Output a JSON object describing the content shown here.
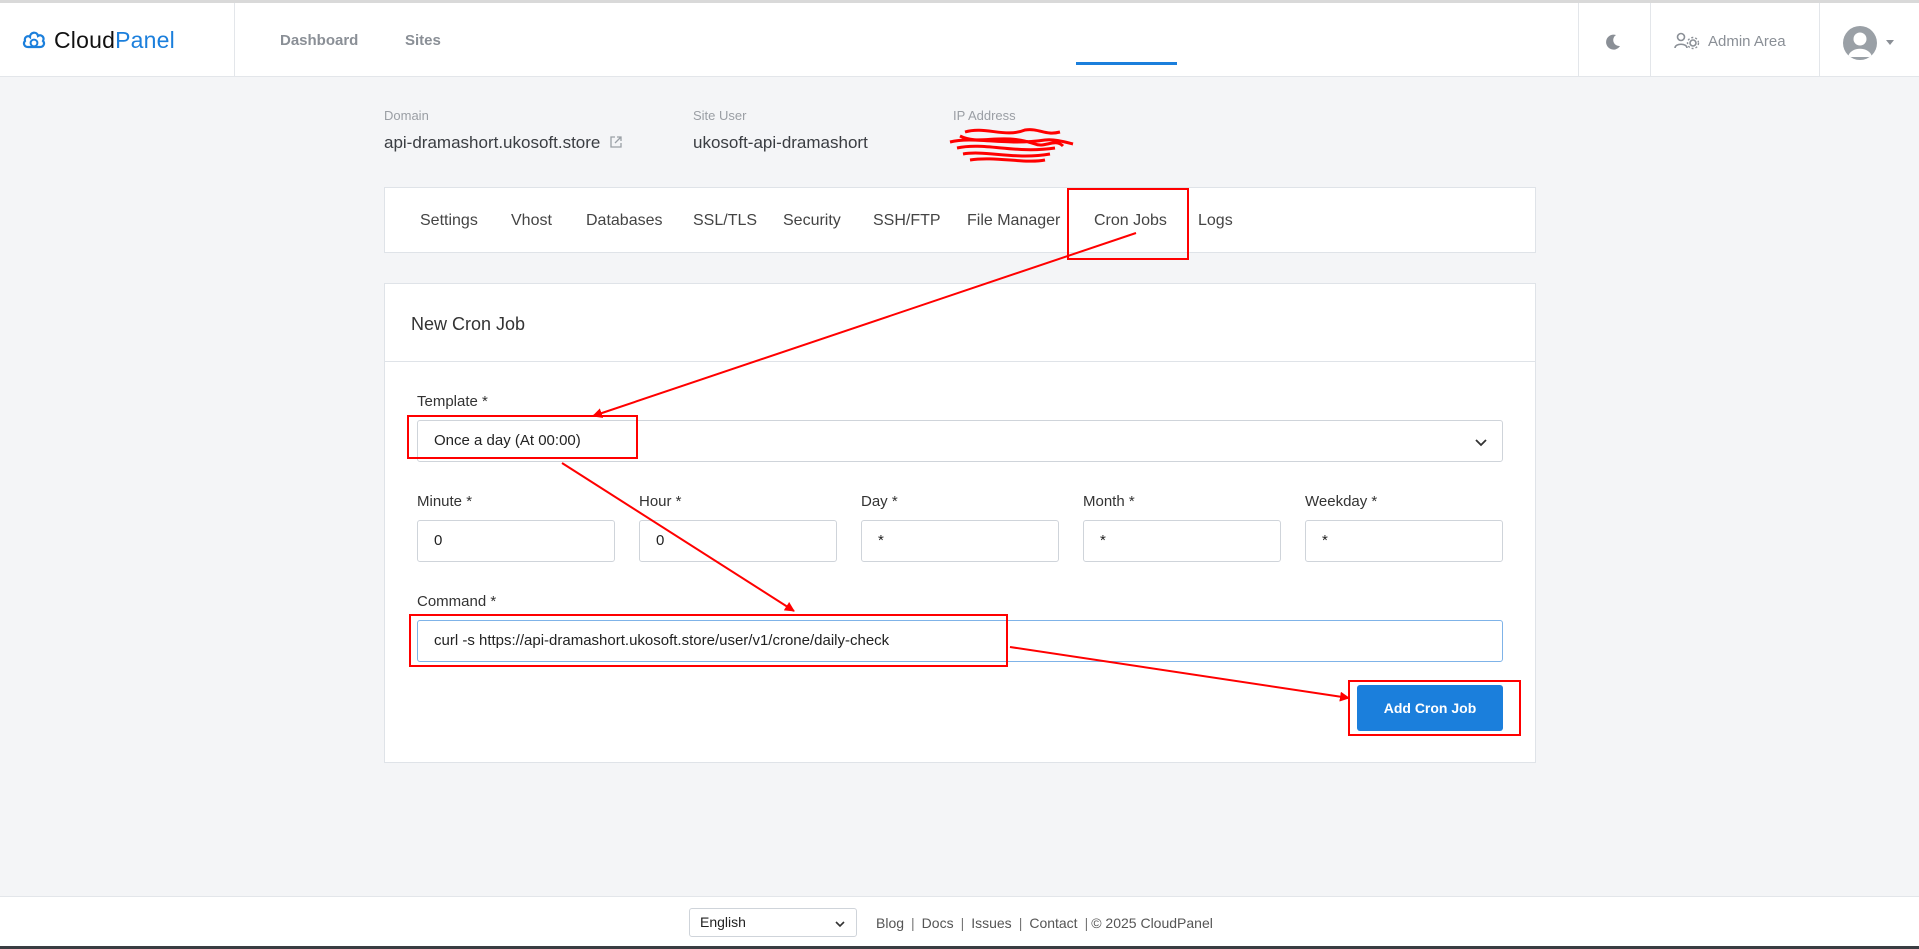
{
  "header": {
    "logo_part1": "Cloud",
    "logo_part2": "Panel",
    "nav": [
      "Dashboard",
      "Sites"
    ],
    "admin_label": "Admin Area",
    "icons": [
      "cloud-icon",
      "moon-icon",
      "admin-gears-icon",
      "avatar-icon",
      "caret-down-icon"
    ]
  },
  "site": {
    "domain_label": "Domain",
    "domain_value": "api-dramashort.ukosoft.store",
    "user_label": "Site User",
    "user_value": "ukosoft-api-dramashort",
    "ip_label": "IP Address"
  },
  "tabs": [
    "Settings",
    "Vhost",
    "Databases",
    "SSL/TLS",
    "Security",
    "SSH/FTP",
    "File Manager",
    "Cron Jobs",
    "Logs"
  ],
  "active_tab": "Cron Jobs",
  "form": {
    "title": "New Cron Job",
    "template_label": "Template *",
    "template_value": "Once a day (At 00:00)",
    "minute_label": "Minute *",
    "minute_value": "0",
    "hour_label": "Hour *",
    "hour_value": "0",
    "day_label": "Day *",
    "day_value": "*",
    "month_label": "Month *",
    "month_value": "*",
    "weekday_label": "Weekday *",
    "weekday_value": "*",
    "command_label": "Command *",
    "command_value": "curl -s https://api-dramashort.ukosoft.store/user/v1/crone/daily-check",
    "submit_label": "Add Cron Job"
  },
  "footer": {
    "language": "English",
    "blog": "Blog",
    "docs": "Docs",
    "issues": "Issues",
    "contact": "Contact",
    "copyright": "© 2025  CloudPanel"
  },
  "colors": {
    "accent": "#1b7fdc",
    "annotation": "#ff0000"
  }
}
